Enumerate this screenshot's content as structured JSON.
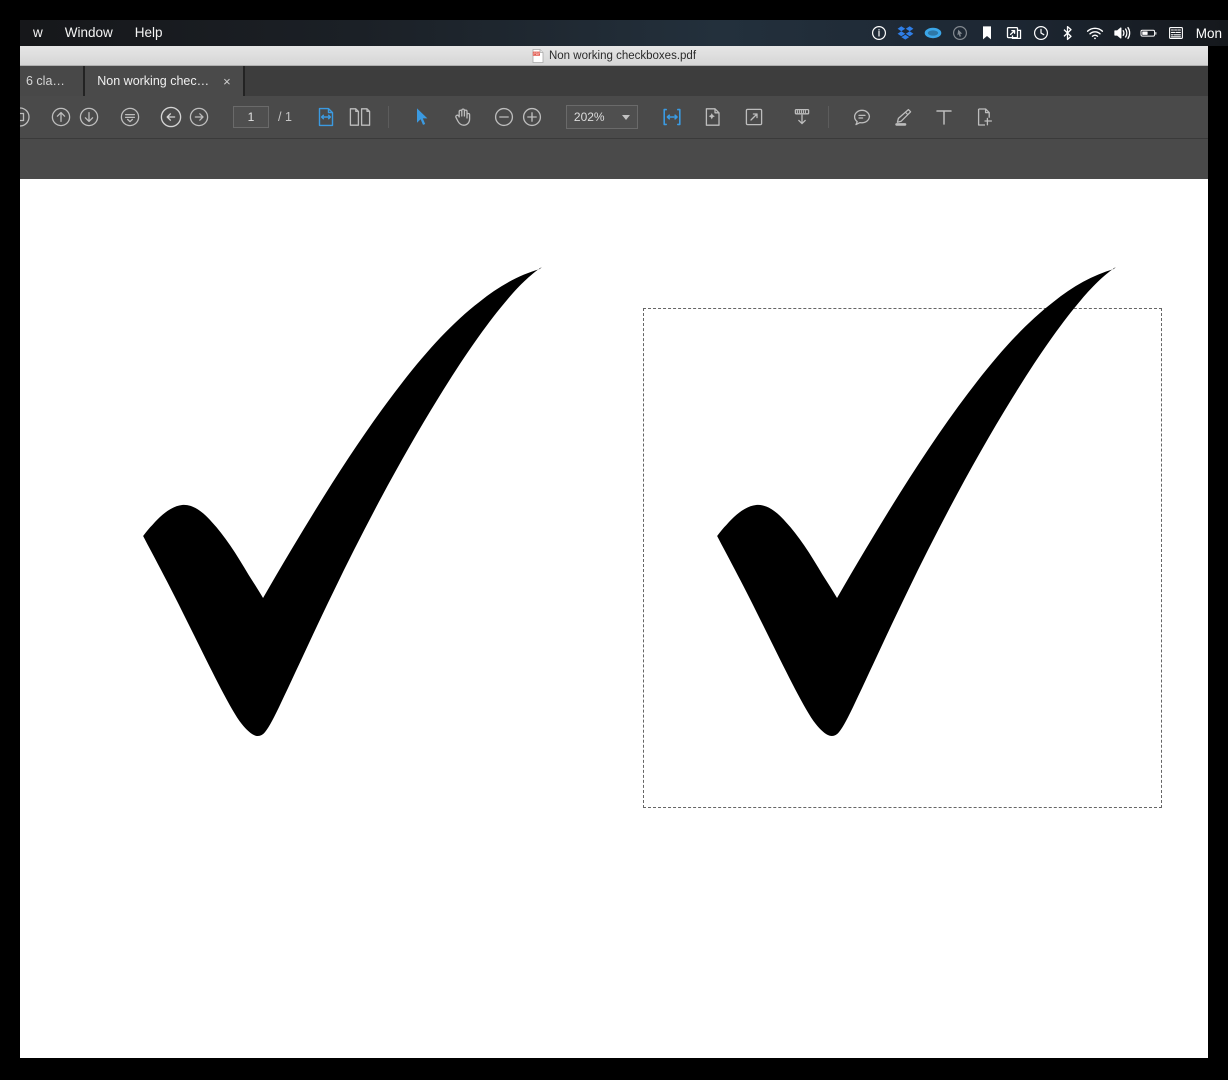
{
  "menubar": {
    "items": [
      {
        "label": "w",
        "name": "menu-view-truncated"
      },
      {
        "label": "Window",
        "name": "menu-window"
      },
      {
        "label": "Help",
        "name": "menu-help"
      }
    ],
    "status_icons": [
      {
        "name": "info-circle-icon",
        "style": "plain"
      },
      {
        "name": "dropbox-icon",
        "style": "dropbox"
      },
      {
        "name": "creative-cloud-icon",
        "style": "blue"
      },
      {
        "name": "cursor-circle-icon",
        "style": "dim"
      },
      {
        "name": "bookmark-icon",
        "style": "plain"
      },
      {
        "name": "screen-share-icon",
        "style": "plain"
      },
      {
        "name": "time-machine-icon",
        "style": "plain"
      },
      {
        "name": "bluetooth-icon",
        "style": "plain"
      },
      {
        "name": "wifi-icon",
        "style": "plain"
      },
      {
        "name": "volume-icon",
        "style": "plain"
      },
      {
        "name": "battery-icon",
        "style": "plain"
      },
      {
        "name": "input-source-icon",
        "style": "plain"
      }
    ],
    "clock": "Mon"
  },
  "titlebar": {
    "title": "Non working checkboxes.pdf",
    "icon": "pdf-file-icon"
  },
  "tabs": [
    {
      "label": "6 cla…",
      "active": false,
      "name": "tab-6-classes"
    },
    {
      "label": "Non working chec…",
      "active": true,
      "close": "×",
      "name": "tab-non-working-checkboxes"
    }
  ],
  "toolbar": {
    "groups": {
      "navigation": [
        {
          "name": "sidebar-toggle-icon",
          "label": "Sidebar"
        },
        {
          "name": "page-up-icon",
          "label": "Previous page"
        },
        {
          "name": "page-down-icon",
          "label": "Next page"
        },
        {
          "name": "fit-page-circle-icon",
          "label": "Fit page"
        },
        {
          "name": "back-icon",
          "label": "Back"
        },
        {
          "name": "forward-icon",
          "label": "Forward"
        }
      ],
      "view_modes": [
        {
          "name": "single-page-view-icon",
          "label": "Single page",
          "active": true
        },
        {
          "name": "two-page-view-icon",
          "label": "Two pages",
          "active": false
        }
      ],
      "tools": [
        {
          "name": "select-tool-icon",
          "label": "Select",
          "active": true
        },
        {
          "name": "hand-tool-icon",
          "label": "Pan",
          "active": false
        },
        {
          "name": "zoom-out-icon",
          "label": "Zoom out"
        },
        {
          "name": "zoom-in-icon",
          "label": "Zoom in"
        }
      ],
      "fit": [
        {
          "name": "fit-width-icon",
          "label": "Fit width",
          "active": true
        },
        {
          "name": "fit-visible-icon",
          "label": "Fit visible",
          "active": false
        },
        {
          "name": "fullscreen-icon",
          "label": "Full screen",
          "active": false
        },
        {
          "name": "download-icon",
          "label": "Download"
        }
      ],
      "annotate": [
        {
          "name": "comment-icon",
          "label": "Comment"
        },
        {
          "name": "highlighter-icon",
          "label": "Highlight"
        },
        {
          "name": "text-tool-icon",
          "label": "Add text"
        },
        {
          "name": "crop-page-icon",
          "label": "Crop page"
        }
      ]
    },
    "page_number": "1",
    "page_total": "/ 1",
    "zoom_level": "202%"
  },
  "document": {
    "objects": [
      {
        "name": "checkmark-left",
        "type": "checkmark-graphic",
        "selected": false
      },
      {
        "name": "checkmark-right",
        "type": "checkmark-graphic",
        "selected": true
      }
    ],
    "selection_border": "dashed"
  },
  "colors": {
    "accent": "#3b9ae1",
    "menubar": "#1d2733",
    "toolbar": "#4a4a4a",
    "tab_active": "#4a4a4a",
    "page": "#ffffff",
    "ink": "#000000"
  }
}
